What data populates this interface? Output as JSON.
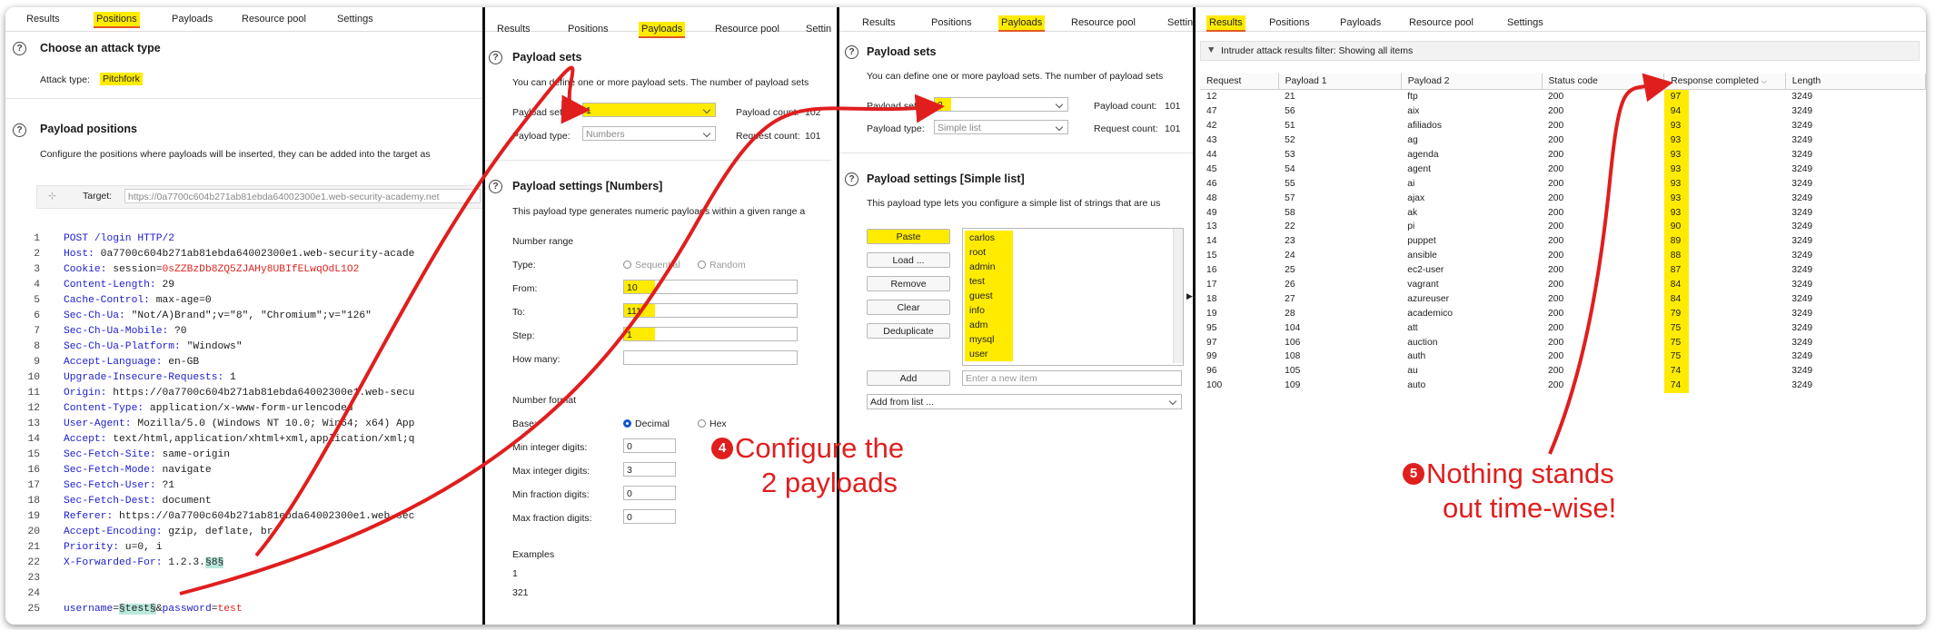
{
  "panel1": {
    "tabs": [
      "Results",
      "Positions",
      "Payloads",
      "Resource pool",
      "Settings"
    ],
    "attack_header": "Choose an attack type",
    "attack_label": "Attack type:",
    "attack_value": "Pitchfork",
    "positions_header": "Payload positions",
    "positions_desc": "Configure the positions where payloads will be inserted, they can be added into the target as",
    "target_label": "Target:",
    "target_value": "https://0a7700c604b271ab81ebda64002300e1.web-security-academy.net",
    "lines": [
      {
        "n": "1",
        "a": "POST /login HTTP/2",
        "b": ""
      },
      {
        "n": "2",
        "a": "Host:",
        "b": " 0a7700c604b271ab81ebda64002300e1.web-security-acade"
      },
      {
        "n": "3",
        "a": "Cookie:",
        "b": " session=",
        "c": "0sZZBzDb8ZQ5ZJAHy8UBIfELwqOdL1O2"
      },
      {
        "n": "4",
        "a": "Content-Length:",
        "b": " 29"
      },
      {
        "n": "5",
        "a": "Cache-Control:",
        "b": " max-age=0"
      },
      {
        "n": "6",
        "a": "Sec-Ch-Ua:",
        "b": " \"Not/A)Brand\";v=\"8\", \"Chromium\";v=\"126\""
      },
      {
        "n": "7",
        "a": "Sec-Ch-Ua-Mobile:",
        "b": " ?0"
      },
      {
        "n": "8",
        "a": "Sec-Ch-Ua-Platform:",
        "b": " \"Windows\""
      },
      {
        "n": "9",
        "a": "Accept-Language:",
        "b": " en-GB"
      },
      {
        "n": "10",
        "a": "Upgrade-Insecure-Requests:",
        "b": " 1"
      },
      {
        "n": "11",
        "a": "Origin:",
        "b": " https://0a7700c604b271ab81ebda64002300e1.web-secu"
      },
      {
        "n": "12",
        "a": "Content-Type:",
        "b": " application/x-www-form-urlencoded"
      },
      {
        "n": "13",
        "a": "User-Agent:",
        "b": " Mozilla/5.0 (Windows NT 10.0; Win64; x64) App"
      },
      {
        "n": "14",
        "a": "Accept:",
        "b": " text/html,application/xhtml+xml,application/xml;q"
      },
      {
        "n": "15",
        "a": "Sec-Fetch-Site:",
        "b": " same-origin"
      },
      {
        "n": "16",
        "a": "Sec-Fetch-Mode:",
        "b": " navigate"
      },
      {
        "n": "17",
        "a": "Sec-Fetch-User:",
        "b": " ?1"
      },
      {
        "n": "18",
        "a": "Sec-Fetch-Dest:",
        "b": " document"
      },
      {
        "n": "19",
        "a": "Referer:",
        "b": " https://0a7700c604b271ab81ebda64002300e1.web-sec"
      },
      {
        "n": "20",
        "a": "Accept-Encoding:",
        "b": " gzip, deflate, br"
      },
      {
        "n": "21",
        "a": "Priority:",
        "b": " u=0, i"
      },
      {
        "n": "22",
        "a": "X-Forwarded-For:",
        "b": " 1.2.3.",
        "m": "§8§"
      },
      {
        "n": "23",
        "a": "",
        "b": ""
      },
      {
        "n": "24",
        "a": "",
        "b": ""
      }
    ],
    "last_line": {
      "n": "25",
      "k1": "username",
      "eq1": "=",
      "m": "§test§",
      "amp": "&",
      "k2": "password",
      "eq2": "=",
      "v": "test"
    }
  },
  "panel2": {
    "tabs": [
      "Results",
      "Positions",
      "Payloads",
      "Resource pool",
      "Settin"
    ],
    "sets_header": "Payload sets",
    "sets_desc": "You can define one or more payload sets. The number of payload sets",
    "set_label": "Payload set:",
    "set_value": "1",
    "count_label": "Payload count:",
    "count_value": "102",
    "type_label": "Payload type:",
    "type_value": "Numbers",
    "req_label": "Request count:",
    "req_value": "101",
    "settings_header": "Payload settings [Numbers]",
    "settings_desc": "This payload type generates numeric payloads within a given range a",
    "range_label": "Number range",
    "type2_label": "Type:",
    "sequential": "Sequential",
    "random": "Random",
    "from_label": "From:",
    "from_value": "10",
    "to_label": "To:",
    "to_value": "111",
    "step_label": "Step:",
    "step_value": "1",
    "howmany_label": "How many:",
    "format_label": "Number format",
    "base_label": "Base:",
    "decimal": "Decimal",
    "hex": "Hex",
    "min_int_label": "Min integer digits:",
    "min_int_value": "0",
    "max_int_label": "Max integer digits:",
    "max_int_value": "3",
    "min_frac_label": "Min fraction digits:",
    "min_frac_value": "0",
    "max_frac_label": "Max fraction digits:",
    "max_frac_value": "0",
    "examples_label": "Examples",
    "ex1": "1",
    "ex2": "321"
  },
  "panel3": {
    "tabs": [
      "Results",
      "Positions",
      "Payloads",
      "Resource pool",
      "Settin"
    ],
    "sets_header": "Payload sets",
    "sets_desc": "You can define one or more payload sets. The number of payload sets",
    "set_label": "Payload set:",
    "set_value": "2",
    "count_label": "Payload count:",
    "count_value": "101",
    "type_label": "Payload type:",
    "type_value": "Simple list",
    "req_label": "Request count:",
    "req_value": "101",
    "settings_header": "Payload settings [Simple list]",
    "settings_desc": "This payload type lets you configure a simple list of strings that are us",
    "buttons": [
      "Paste",
      "Load ...",
      "Remove",
      "Clear",
      "Deduplicate"
    ],
    "items": [
      "carlos",
      "root",
      "admin",
      "test",
      "guest",
      "info",
      "adm",
      "mysql",
      "user"
    ],
    "add_button": "Add",
    "add_placeholder": "Enter a new item",
    "add_from_list": "Add from list ..."
  },
  "panel4": {
    "tabs": [
      "Results",
      "Positions",
      "Payloads",
      "Resource pool",
      "Settings"
    ],
    "filter_text": "Intruder attack results filter: Showing all items",
    "columns": [
      "Request",
      "Payload 1",
      "Payload 2",
      "Status code",
      "Response completed",
      "Length"
    ],
    "rows": [
      [
        "12",
        "21",
        "ftp",
        "200",
        "97",
        "3249"
      ],
      [
        "47",
        "56",
        "aix",
        "200",
        "94",
        "3249"
      ],
      [
        "42",
        "51",
        "afiliados",
        "200",
        "93",
        "3249"
      ],
      [
        "43",
        "52",
        "ag",
        "200",
        "93",
        "3249"
      ],
      [
        "44",
        "53",
        "agenda",
        "200",
        "93",
        "3249"
      ],
      [
        "45",
        "54",
        "agent",
        "200",
        "93",
        "3249"
      ],
      [
        "46",
        "55",
        "ai",
        "200",
        "93",
        "3249"
      ],
      [
        "48",
        "57",
        "ajax",
        "200",
        "93",
        "3249"
      ],
      [
        "49",
        "58",
        "ak",
        "200",
        "93",
        "3249"
      ],
      [
        "13",
        "22",
        "pi",
        "200",
        "90",
        "3249"
      ],
      [
        "14",
        "23",
        "puppet",
        "200",
        "89",
        "3249"
      ],
      [
        "15",
        "24",
        "ansible",
        "200",
        "88",
        "3249"
      ],
      [
        "16",
        "25",
        "ec2-user",
        "200",
        "87",
        "3249"
      ],
      [
        "17",
        "26",
        "vagrant",
        "200",
        "84",
        "3249"
      ],
      [
        "18",
        "27",
        "azureuser",
        "200",
        "84",
        "3249"
      ],
      [
        "19",
        "28",
        "academico",
        "200",
        "79",
        "3249"
      ],
      [
        "95",
        "104",
        "att",
        "200",
        "75",
        "3249"
      ],
      [
        "97",
        "106",
        "auction",
        "200",
        "75",
        "3249"
      ],
      [
        "99",
        "108",
        "auth",
        "200",
        "75",
        "3249"
      ],
      [
        "96",
        "105",
        "au",
        "200",
        "74",
        "3249"
      ],
      [
        "100",
        "109",
        "auto",
        "200",
        "74",
        "3249"
      ]
    ]
  },
  "annotations": {
    "step4_num": "4",
    "step4_line1": "Configure the",
    "step4_line2": "2 payloads",
    "step5_num": "5",
    "step5_line1": "Nothing stands",
    "step5_line2": "out time-wise!"
  },
  "colors": {
    "highlight": "#ffeb00",
    "accent": "#e25822",
    "arrow": "#e01e1e"
  }
}
